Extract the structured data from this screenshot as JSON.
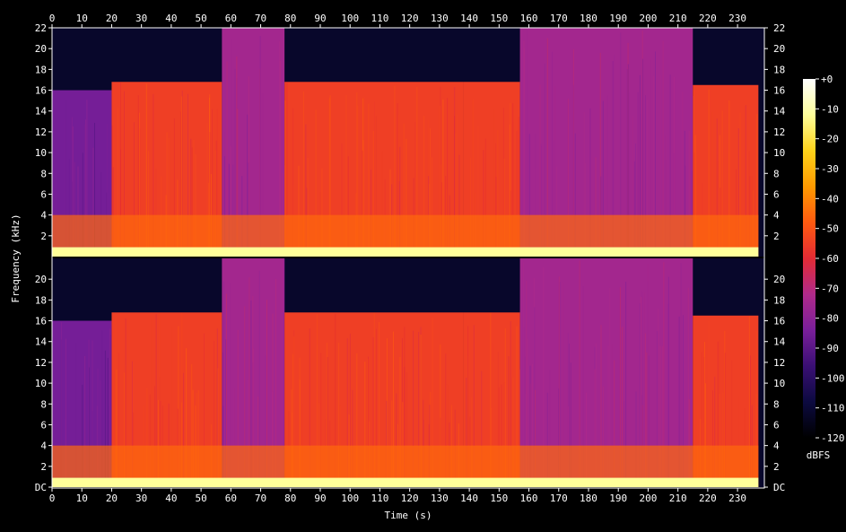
{
  "chart_data": {
    "type": "heatmap",
    "title": "",
    "xlabel": "Time (s)",
    "ylabel": "Frequency (kHz)",
    "colorbar_label": "dBFS",
    "xlim": [
      0,
      239
    ],
    "ylim": [
      0,
      22
    ],
    "x_ticks": [
      0,
      10,
      20,
      30,
      40,
      50,
      60,
      70,
      80,
      90,
      100,
      110,
      120,
      130,
      140,
      150,
      160,
      170,
      180,
      190,
      200,
      210,
      220,
      230
    ],
    "y_ticks_top": [
      "2",
      "4",
      "6",
      "8",
      "10",
      "12",
      "14",
      "16",
      "18",
      "20",
      "22"
    ],
    "y_ticks_bottom": [
      "DC",
      "2",
      "4",
      "6",
      "8",
      "10",
      "12",
      "14",
      "16",
      "18",
      "20"
    ],
    "colorbar_ticks": [
      "+0",
      "-10",
      "-20",
      "-30",
      "-40",
      "-50",
      "-60",
      "-70",
      "-80",
      "-90",
      "-100",
      "-110",
      "-120"
    ],
    "colorbar_range": [
      -120,
      0
    ],
    "channels": 2,
    "colormap": [
      "#000000",
      "#0c0a40",
      "#3a0f74",
      "#7a1f9a",
      "#b02a8a",
      "#e32b34",
      "#ff5a10",
      "#ff9a00",
      "#ffd31a",
      "#ffff9a",
      "#ffffff"
    ],
    "segments": [
      {
        "t0": 0,
        "t1": 20,
        "cutoff_khz": 16.0,
        "level_db": -85
      },
      {
        "t0": 20,
        "t1": 57,
        "cutoff_khz": 16.8,
        "level_db": -55
      },
      {
        "t0": 57,
        "t1": 78,
        "cutoff_khz": 22.0,
        "level_db": -75
      },
      {
        "t0": 78,
        "t1": 138,
        "cutoff_khz": 16.8,
        "level_db": -55
      },
      {
        "t0": 138,
        "t1": 157,
        "cutoff_khz": 16.8,
        "level_db": -55
      },
      {
        "t0": 157,
        "t1": 215,
        "cutoff_khz": 22.0,
        "level_db": -75
      },
      {
        "t0": 215,
        "t1": 237,
        "cutoff_khz": 16.5,
        "level_db": -55
      }
    ]
  }
}
